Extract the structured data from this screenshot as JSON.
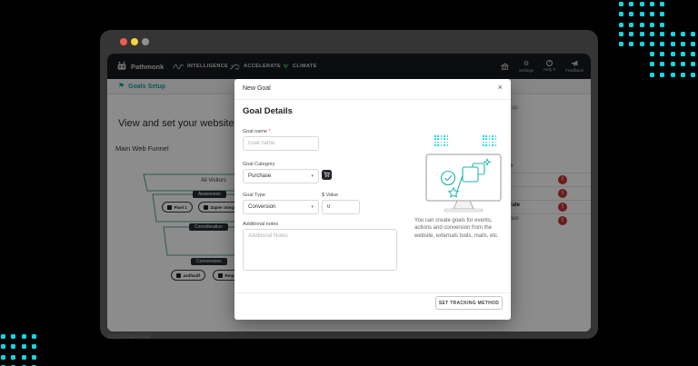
{
  "colors": {
    "dot_cyan": "#10d7e2",
    "accent_teal": "#14a79c",
    "badge_red": "#c2382e",
    "climate_green": "#35b24a",
    "required_red": "#e0443a"
  },
  "icons": {
    "chevron": "▾",
    "close": "×",
    "gear": "⚙",
    "help_mark": "?",
    "exclaim": "!",
    "asterisk": "*",
    "flag": "⚑"
  },
  "window": {
    "footer_note": "© 2023 Pathmonk"
  },
  "nav": {
    "brand": "Pathmonk",
    "items": [
      {
        "label": "INTELLIGENCE"
      },
      {
        "label": "ACCELERATE"
      },
      {
        "label": "CLIMATE"
      }
    ],
    "right": [
      {
        "label": "Settings"
      },
      {
        "label": "Help"
      },
      {
        "label": "Feedback"
      }
    ]
  },
  "subheader": {
    "title": "Goals Setup"
  },
  "page": {
    "heading": "View and set your website goals",
    "section_label": "Main Web Funnel",
    "funnel": {
      "top_label": "All Visitors",
      "stage1_label": "Awareness",
      "stage1_buttons": [
        {
          "label": "Pixel 1"
        },
        {
          "label": "Zapier integration"
        }
      ],
      "stage2_label": "Consideration",
      "stage3_label": "Conversions",
      "stage3_buttons": [
        {
          "label": "asdfasdf"
        },
        {
          "label": "Request Demo"
        }
      ]
    },
    "occluded_fragments": [
      "up",
      "e",
      "rate",
      "tion"
    ]
  },
  "modal": {
    "title": "New Goal",
    "section_title": "Goal Details",
    "goal_name_label": "Goal name",
    "goal_name_placeholder": "Goal name",
    "goal_category_label": "Goal Category",
    "goal_category_value": "Purchase",
    "goal_type_label": "Goal Type",
    "goal_type_value": "Conversion",
    "value_label": "$ Value",
    "value_value": "0",
    "notes_label": "Additional notes",
    "notes_placeholder": "Additional Notes",
    "help_text": "You can create goals for events, actions and conversion from the website, externals tools, mails, etc.",
    "footer_button": "SET TRACKING METHOD"
  }
}
